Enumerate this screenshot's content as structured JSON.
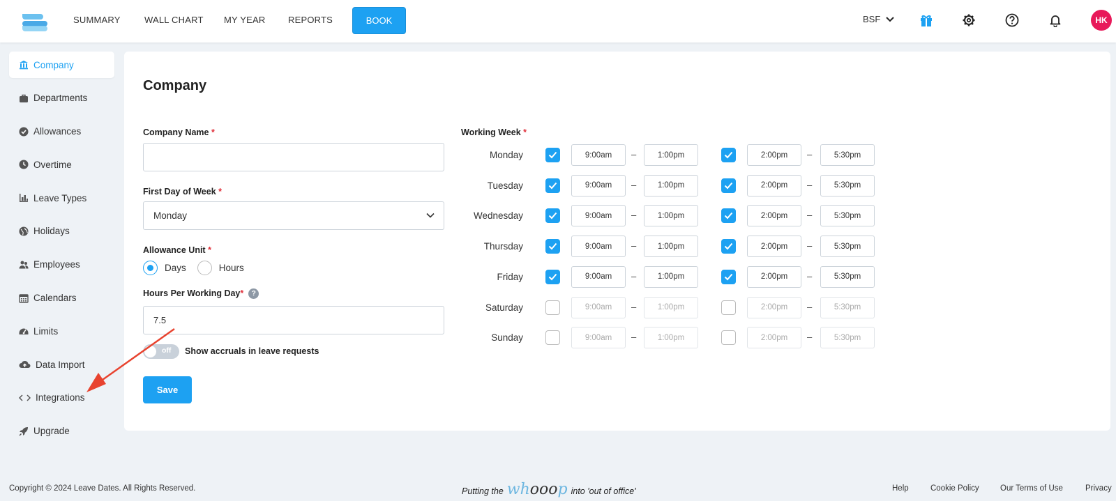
{
  "nav": {
    "items": [
      "SUMMARY",
      "WALL CHART",
      "MY YEAR",
      "REPORTS"
    ],
    "book_label": "BOOK",
    "org": "BSF",
    "avatar_initials": "HK"
  },
  "colors": {
    "accent": "#1da1f2",
    "avatar": "#e8195a",
    "annotation": "#e8432f"
  },
  "sidebar": {
    "items": [
      {
        "label": "Company",
        "icon": "bank-icon",
        "active": true
      },
      {
        "label": "Departments",
        "icon": "briefcase-icon"
      },
      {
        "label": "Allowances",
        "icon": "check-circle-icon"
      },
      {
        "label": "Overtime",
        "icon": "clock-icon"
      },
      {
        "label": "Leave Types",
        "icon": "chart-icon"
      },
      {
        "label": "Holidays",
        "icon": "globe-icon"
      },
      {
        "label": "Employees",
        "icon": "users-icon"
      },
      {
        "label": "Calendars",
        "icon": "calendar-icon"
      },
      {
        "label": "Limits",
        "icon": "gauge-icon"
      },
      {
        "label": "Data Import",
        "icon": "cloud-upload-icon"
      },
      {
        "label": "Integrations",
        "icon": "code-icon"
      },
      {
        "label": "Upgrade",
        "icon": "rocket-icon"
      }
    ]
  },
  "main": {
    "title": "Company",
    "company_name": {
      "label": "Company Name",
      "value": "",
      "required": "*"
    },
    "first_day": {
      "label": "First Day of Week",
      "value": "Monday",
      "required": "*"
    },
    "allowance_unit": {
      "label": "Allowance Unit",
      "required": "*",
      "options": [
        "Days",
        "Hours"
      ],
      "selected": "Days"
    },
    "hours_per_day": {
      "label": "Hours Per Working Day",
      "required": "*",
      "value": "7.5",
      "help": "?"
    },
    "accruals": {
      "toggle_text": "off",
      "label": "Show accruals in leave requests"
    },
    "save_label": "Save"
  },
  "working_week": {
    "label": "Working Week",
    "required": "*",
    "dash": "–",
    "days": [
      {
        "name": "Monday",
        "enabled": true,
        "am_start": "9:00am",
        "am_end": "1:00pm",
        "pm_start": "2:00pm",
        "pm_end": "5:30pm"
      },
      {
        "name": "Tuesday",
        "enabled": true,
        "am_start": "9:00am",
        "am_end": "1:00pm",
        "pm_start": "2:00pm",
        "pm_end": "5:30pm"
      },
      {
        "name": "Wednesday",
        "enabled": true,
        "am_start": "9:00am",
        "am_end": "1:00pm",
        "pm_start": "2:00pm",
        "pm_end": "5:30pm"
      },
      {
        "name": "Thursday",
        "enabled": true,
        "am_start": "9:00am",
        "am_end": "1:00pm",
        "pm_start": "2:00pm",
        "pm_end": "5:30pm"
      },
      {
        "name": "Friday",
        "enabled": true,
        "am_start": "9:00am",
        "am_end": "1:00pm",
        "pm_start": "2:00pm",
        "pm_end": "5:30pm"
      },
      {
        "name": "Saturday",
        "enabled": false,
        "am_start": "9:00am",
        "am_end": "1:00pm",
        "pm_start": "2:00pm",
        "pm_end": "5:30pm"
      },
      {
        "name": "Sunday",
        "enabled": false,
        "am_start": "9:00am",
        "am_end": "1:00pm",
        "pm_start": "2:00pm",
        "pm_end": "5:30pm"
      }
    ]
  },
  "footer": {
    "copyright": "Copyright © 2024 Leave Dates. All Rights Reserved.",
    "tagline_before": "Putting the",
    "tagline_whoop_a": "wh",
    "tagline_whoop_b": "ooo",
    "tagline_whoop_c": "p",
    "tagline_after": "into 'out of office'",
    "links": [
      "Help",
      "Cookie Policy",
      "Our Terms of Use",
      "Privacy"
    ]
  }
}
